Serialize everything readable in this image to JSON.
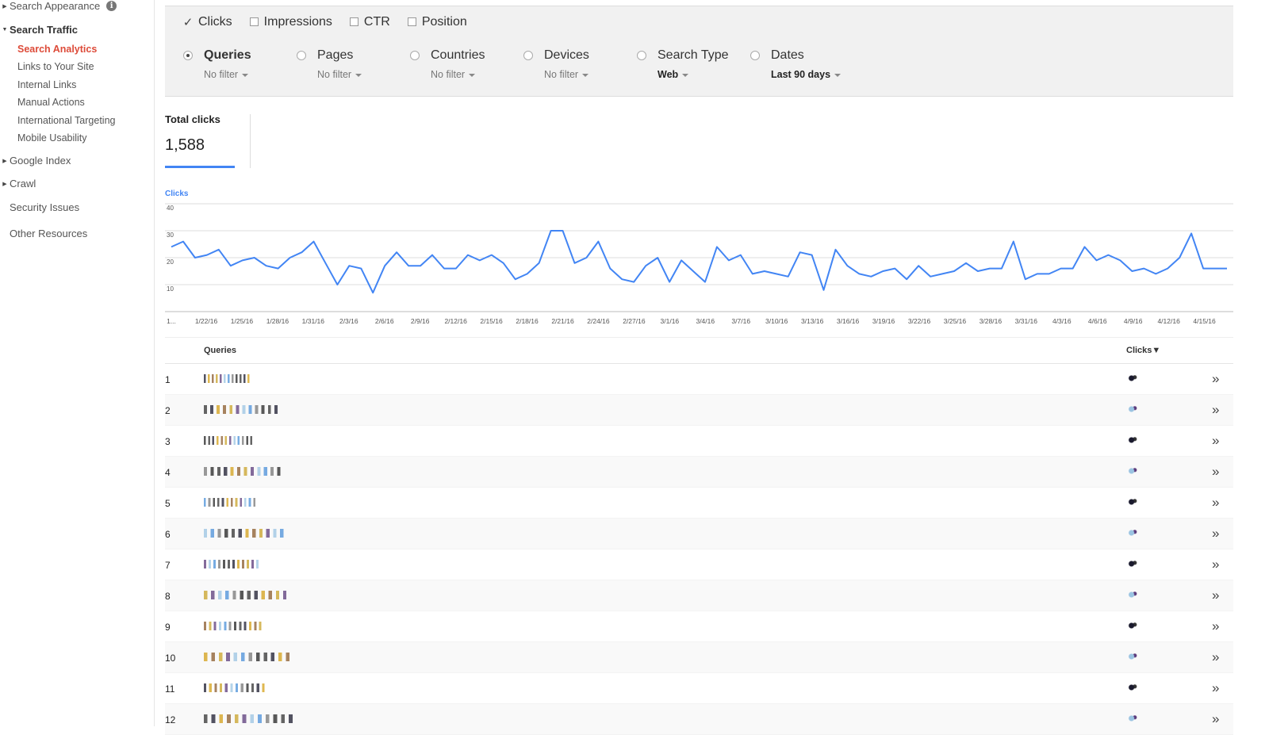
{
  "sidebar": {
    "search_appearance": "Search Appearance",
    "info": "i",
    "search_traffic": "Search Traffic",
    "sub": [
      "Search Analytics",
      "Links to Your Site",
      "Internal Links",
      "Manual Actions",
      "International Targeting",
      "Mobile Usability"
    ],
    "google_index": "Google Index",
    "crawl": "Crawl",
    "security_issues": "Security Issues",
    "other_resources": "Other Resources"
  },
  "metrics": {
    "clicks": "Clicks",
    "clicks_checked": true,
    "impressions": "Impressions",
    "ctr": "CTR",
    "position": "Position"
  },
  "groupby": [
    {
      "label": "Queries",
      "filter": "No filter",
      "selected": true
    },
    {
      "label": "Pages",
      "filter": "No filter",
      "selected": false
    },
    {
      "label": "Countries",
      "filter": "No filter",
      "selected": false
    },
    {
      "label": "Devices",
      "filter": "No filter",
      "selected": false
    },
    {
      "label": "Search Type",
      "filter": "Web",
      "selected": false
    },
    {
      "label": "Dates",
      "filter": "Last 90 days",
      "selected": false
    }
  ],
  "total": {
    "title": "Total clicks",
    "value": "1,588"
  },
  "chart_data": {
    "type": "line",
    "series_label": "Clicks",
    "ylim": [
      0,
      40
    ],
    "y_ticks": [
      "40",
      "30",
      "20",
      "10"
    ],
    "x_labels": [
      "1...",
      "1/22/16",
      "1/25/16",
      "1/28/16",
      "1/31/16",
      "2/3/16",
      "2/6/16",
      "2/9/16",
      "2/12/16",
      "2/15/16",
      "2/18/16",
      "2/21/16",
      "2/24/16",
      "2/27/16",
      "3/1/16",
      "3/4/16",
      "3/7/16",
      "3/10/16",
      "3/13/16",
      "3/16/16",
      "3/19/16",
      "3/22/16",
      "3/25/16",
      "3/28/16",
      "3/31/16",
      "4/3/16",
      "4/6/16",
      "4/9/16",
      "4/12/16",
      "4/15/16"
    ],
    "values": [
      24,
      26,
      20,
      21,
      23,
      17,
      19,
      20,
      17,
      16,
      20,
      22,
      26,
      18,
      10,
      17,
      16,
      7,
      17,
      22,
      17,
      17,
      21,
      16,
      16,
      21,
      19,
      21,
      18,
      12,
      14,
      18,
      30,
      30,
      18,
      20,
      26,
      16,
      12,
      11,
      17,
      20,
      11,
      19,
      15,
      11,
      24,
      19,
      21,
      14,
      15,
      14,
      13,
      22,
      21,
      8,
      23,
      17,
      14,
      13,
      15,
      16,
      12,
      17,
      13,
      14,
      15,
      18,
      15,
      16,
      16,
      26,
      12,
      14,
      14,
      16,
      16,
      24,
      19,
      21,
      19,
      15,
      16,
      14,
      16,
      20,
      29,
      16,
      16,
      16
    ]
  },
  "table": {
    "queries_header": "Queries",
    "clicks_header": "Clicks▼",
    "expand_icon": "»",
    "rows": [
      "1",
      "2",
      "3",
      "4",
      "5",
      "6",
      "7",
      "8",
      "9",
      "10",
      "11",
      "12"
    ]
  },
  "colors": {
    "accent": "#4285f4",
    "active_nav": "#dd4b39"
  }
}
